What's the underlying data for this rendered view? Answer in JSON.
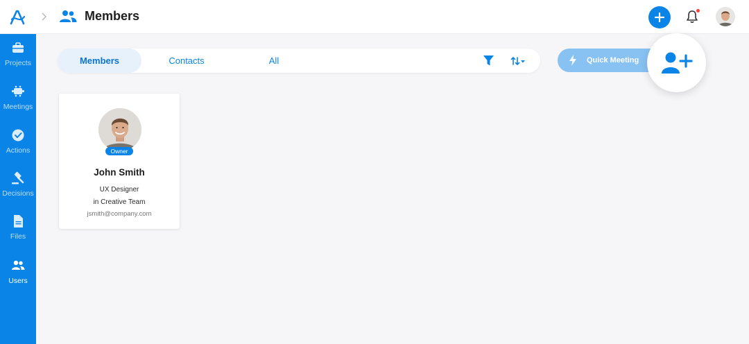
{
  "header": {
    "title": "Members",
    "breadcrumb_icon": "users-icon",
    "logo_icon": "app-logo",
    "add_icon": "plus-icon",
    "notification_icon": "bell-icon",
    "notification_dot_color": "#ff3b3b"
  },
  "sidebar": {
    "items": [
      {
        "label": "Projects",
        "icon": "briefcase-icon",
        "active": false
      },
      {
        "label": "Meetings",
        "icon": "meeting-icon",
        "active": false
      },
      {
        "label": "Actions",
        "icon": "check-circle-icon",
        "active": false
      },
      {
        "label": "Decisions",
        "icon": "gavel-icon",
        "active": false
      },
      {
        "label": "Files",
        "icon": "file-icon",
        "active": false
      },
      {
        "label": "Users",
        "icon": "users-icon",
        "active": true
      }
    ]
  },
  "tabs": [
    {
      "label": "Members",
      "active": true
    },
    {
      "label": "Contacts",
      "active": false
    },
    {
      "label": "All",
      "active": false
    }
  ],
  "toolbar": {
    "filter_icon": "filter-icon",
    "sort_icon": "sort-icon",
    "quick_meeting_label": "Quick Meeting",
    "add_user_icon": "add-user-icon"
  },
  "members": [
    {
      "name": "John Smith",
      "badge": "Owner",
      "role": "UX Designer",
      "team": "in Creative Team",
      "email": "jsmith@company.com"
    }
  ],
  "colors": {
    "accent": "#0a84e6",
    "background": "#f6f6f9",
    "active_tab_bg": "#e6f1fc",
    "quick_meeting_bg": "#88c2f2"
  }
}
